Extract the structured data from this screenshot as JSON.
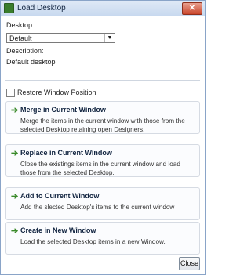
{
  "window": {
    "title": "Load Desktop",
    "close_glyph": "✕"
  },
  "desktop": {
    "label": "Desktop:",
    "selected": "Default",
    "description_label": "Description:",
    "description": "Default desktop"
  },
  "restore": {
    "label": "Restore Window Position",
    "checked": false
  },
  "options": [
    {
      "title": "Merge in Current Window",
      "desc": "Merge the items in the current window with those from the selected Desktop retaining open Designers."
    },
    {
      "title": "Replace in Current Window",
      "desc": "Close the existings items in the current window and load those from the selected Desktop."
    },
    {
      "title": "Add to Current Window",
      "desc": "Add the slected Desktop's items to the current window"
    },
    {
      "title": "Create in New Window",
      "desc": "Load the selected Desktop items in a new Window."
    }
  ],
  "buttons": {
    "close": "Close"
  },
  "icons": {
    "arrow": "➔",
    "dropdown": "▼"
  },
  "colors": {
    "accent_green": "#3a8a2a",
    "title_bar": "#c8d9ef"
  }
}
